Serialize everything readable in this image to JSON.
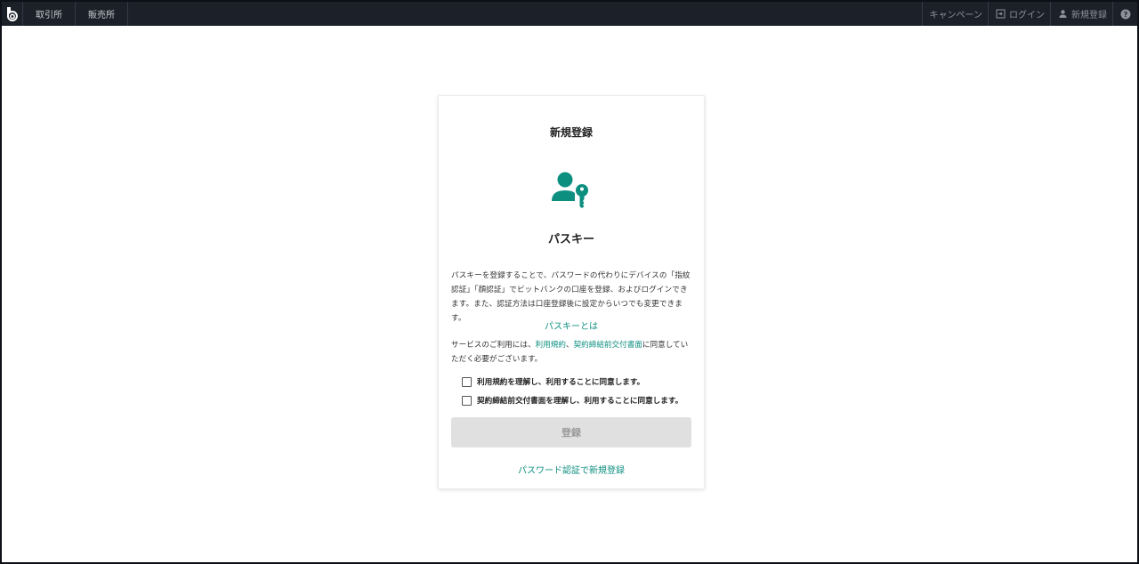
{
  "topbar": {
    "nav": [
      "取引所",
      "販売所"
    ],
    "campaign": "キャンペーン",
    "login": "ログイン",
    "signup": "新規登録"
  },
  "card": {
    "title": "新規登録",
    "subtitle": "パスキー",
    "description": "パスキーを登録することで、パスワードの代わりにデバイスの「指紋認証」「顔認証」でビットバンクの口座を登録、およびログインできます。また、認証方法は口座登録後に設定からいつでも変更できます。",
    "what_is_link": "パスキーとは",
    "agree_prefix": "サービスのご利用には、",
    "agree_link1": "利用規約",
    "agree_sep": "、",
    "agree_link2": "契約締結前交付書面",
    "agree_suffix": "に同意していただく必要がございます。",
    "check1": "利用規約を理解し、利用することに同意します。",
    "check2": "契約締結前交付書面を理解し、利用することに同意します。",
    "register_button": "登録",
    "password_link": "パスワード認証で新規登録"
  },
  "colors": {
    "accent": "#0d8f80",
    "topbar": "#1b2029"
  }
}
